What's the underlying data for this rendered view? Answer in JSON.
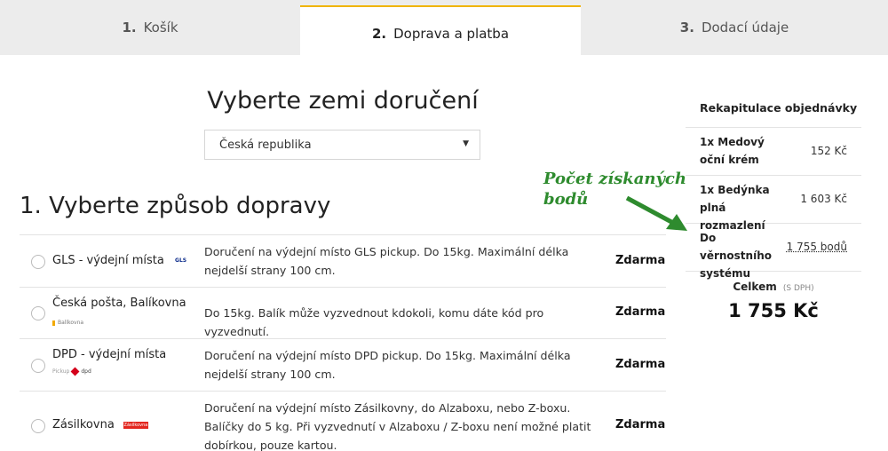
{
  "steps": [
    {
      "num": "1.",
      "label": "Košík"
    },
    {
      "num": "2.",
      "label": "Doprava a platba"
    },
    {
      "num": "3.",
      "label": "Dodací údaje"
    }
  ],
  "country": {
    "title": "Vyberte zemi doručení",
    "selected": "Česká republika"
  },
  "shipping": {
    "title": "1. Vyberte způsob dopravy",
    "options": [
      {
        "name": "GLS - výdejní místa",
        "logo": "GLS",
        "desc": "Doručení na výdejní místo GLS pickup. Do 15kg. Maximální délka nejdelší strany 100 cm.",
        "price": "Zdarma"
      },
      {
        "name": "Česká pošta, Balíkovna",
        "logo": "Balíkovna",
        "desc": "Do 15kg. Balík může vyzvednout kdokoli, komu dáte kód pro vyzvednutí.",
        "price": "Zdarma"
      },
      {
        "name": "DPD - výdejní místa",
        "logo": "Pickup",
        "logo2": "dpd",
        "desc": "Doručení na výdejní místo DPD pickup. Do 15kg. Maximální délka nejdelší strany 100 cm.",
        "price": "Zdarma"
      },
      {
        "name": "Zásilkovna",
        "logo": "Zásilkovna",
        "desc": "Doručení na výdejní místo Zásilkovny, do Alzaboxu, nebo Z-boxu. Balíčky do 5 kg. Při vyzvednutí v Alzaboxu / Z-boxu není možné platit dobírkou, pouze kartou.",
        "price": "Zdarma"
      }
    ]
  },
  "recap": {
    "title": "Rekapitulace objednávky",
    "items": [
      {
        "label": "1x Medový oční krém",
        "value": "152 Kč"
      },
      {
        "label": "1x Bedýnka plná rozmazlení",
        "value": "1 603 Kč"
      },
      {
        "label": "Do věrnostního systému",
        "value": "1 755 bodů"
      }
    ],
    "total_label": "Celkem",
    "total_note": "(S DPH)",
    "total_value": "1 755 Kč"
  },
  "annotation": {
    "text": "Počet získaných bodů",
    "color": "#2e8b2e"
  },
  "colors": {
    "accent": "#f0b400",
    "steps_bg": "#ececec"
  }
}
